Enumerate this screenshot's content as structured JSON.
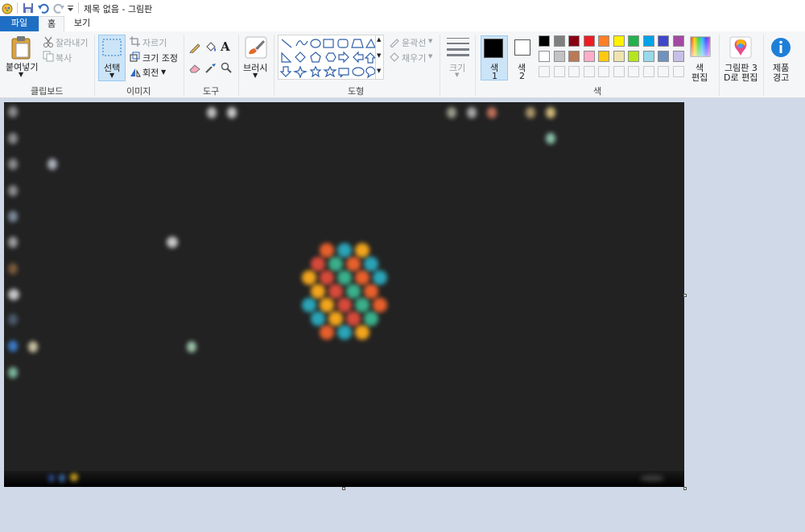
{
  "window": {
    "title": "제목 없음 - 그림판"
  },
  "tabs": {
    "file": "파일",
    "home": "홈",
    "view": "보기"
  },
  "clipboard": {
    "paste": "붙여넣기",
    "cut": "잘라내기",
    "copy": "복사",
    "group": "클립보드"
  },
  "image": {
    "select": "선택",
    "crop": "자르기",
    "resize": "크기 조정",
    "rotate": "회전",
    "group": "이미지"
  },
  "tools": {
    "group": "도구"
  },
  "brushes": {
    "label": "브러시"
  },
  "shapes": {
    "outline": "윤곽선",
    "fill": "채우기",
    "group": "도형"
  },
  "size": {
    "label": "크기"
  },
  "colors": {
    "color1_a": "색",
    "color1_b": "1",
    "color2_a": "색",
    "color2_b": "2",
    "edit_a": "색",
    "edit_b": "편집",
    "group": "색",
    "primary": "#000000",
    "secondary": "#ffffff",
    "palette_row1": [
      "#000000",
      "#7f7f7f",
      "#880015",
      "#ed1c24",
      "#ff7f27",
      "#fff200",
      "#22b14c",
      "#00a2e8",
      "#3f48cc",
      "#a349a4"
    ],
    "palette_row2": [
      "#ffffff",
      "#c3c3c3",
      "#b97a57",
      "#ffaec9",
      "#ffc90e",
      "#efe4b0",
      "#b5e61d",
      "#99d9ea",
      "#7092be",
      "#c8bfe7"
    ],
    "palette_row3": [
      "#f5f6f7",
      "#f5f6f7",
      "#f5f6f7",
      "#f5f6f7",
      "#f5f6f7",
      "#f5f6f7",
      "#f5f6f7",
      "#f5f6f7",
      "#f5f6f7",
      "#f5f6f7"
    ]
  },
  "paint3d": {
    "line1": "그림판 3",
    "line2": "D로 편집"
  },
  "product": {
    "line1": "제품",
    "line2": "경고"
  }
}
